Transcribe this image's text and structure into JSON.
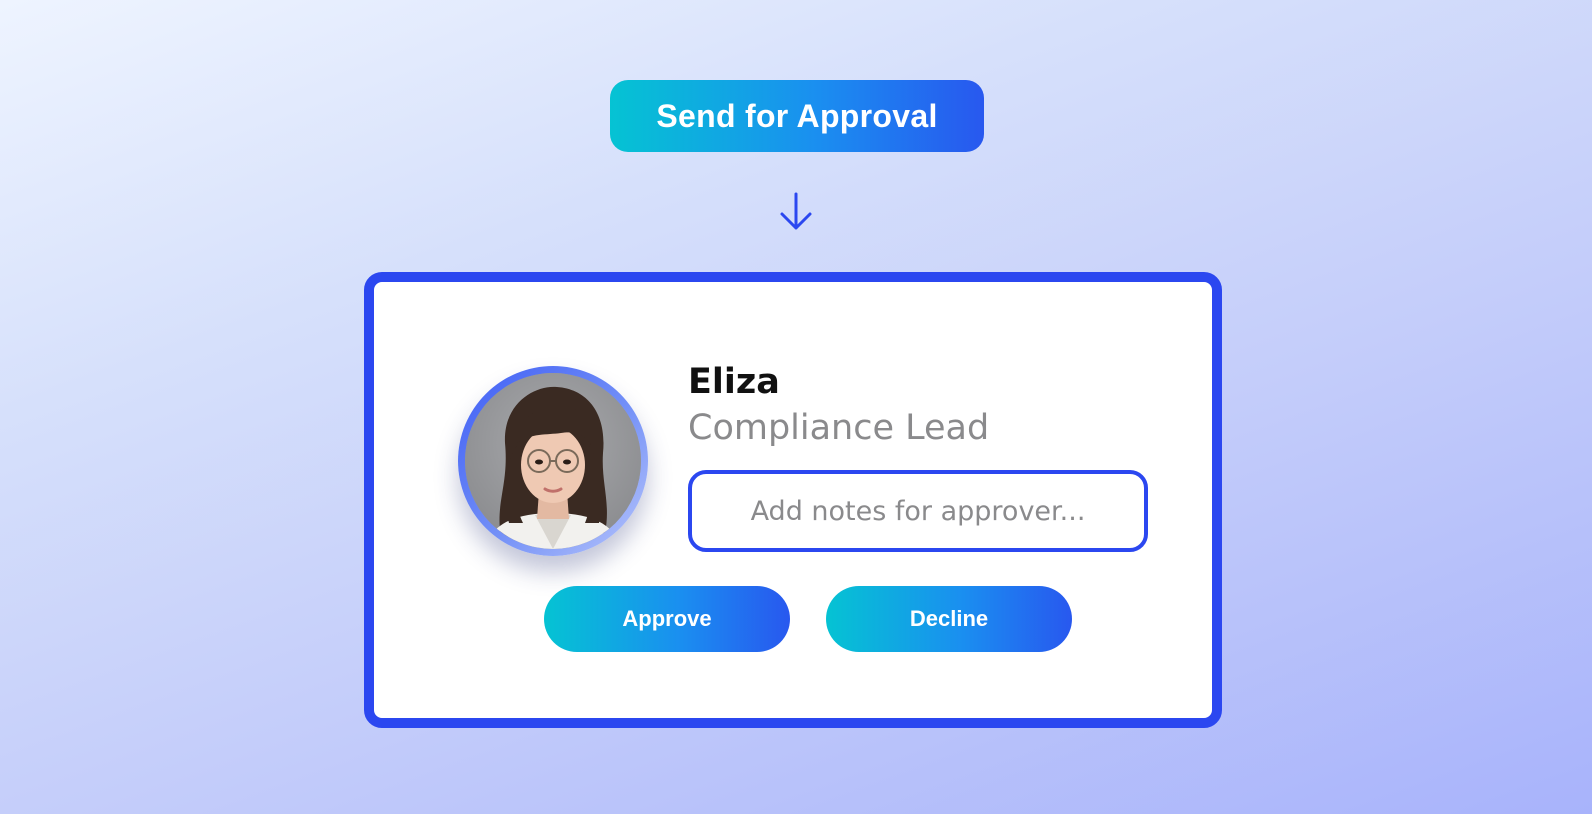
{
  "header": {
    "send_label": "Send for Approval",
    "arrow_icon": "arrow-down-icon"
  },
  "card": {
    "approver": {
      "name": "Eliza",
      "role": "Compliance Lead",
      "avatar": "avatar-photo"
    },
    "notes": {
      "value": "",
      "placeholder": "Add notes for approver..."
    },
    "actions": {
      "approve_label": "Approve",
      "decline_label": "Decline"
    }
  },
  "colors": {
    "accent_blue": "#2b47f0",
    "gradient_start": "#05c3d3",
    "gradient_end": "#2858ef",
    "role_text": "#8a8a8c"
  }
}
